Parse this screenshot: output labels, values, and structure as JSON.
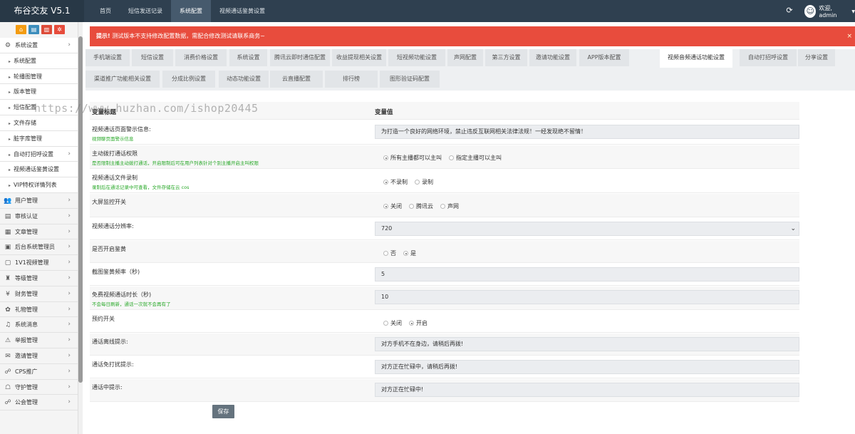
{
  "app": {
    "title": "布谷交友 V5.1"
  },
  "topnav": [
    "首页",
    "短信发送记录",
    "系统配置",
    "视频通话鉴黄设置"
  ],
  "topnav_active": 2,
  "user": {
    "greeting": "欢迎, admin"
  },
  "sidebar": {
    "quick_colors": [
      "#f39c12",
      "#3c8dbc",
      "#dd4b39",
      "#e74c3c"
    ],
    "items": [
      {
        "label": "系统设置",
        "icon": "⚙",
        "icon_name": "gear-icon",
        "type": "group-open",
        "arrow": "›"
      },
      {
        "label": "系统配置",
        "type": "sub"
      },
      {
        "label": "轮播图管理",
        "type": "sub"
      },
      {
        "label": "版本管理",
        "type": "sub"
      },
      {
        "label": "短信配置",
        "type": "sub"
      },
      {
        "label": "文件存储",
        "type": "sub"
      },
      {
        "label": "脏字库管理",
        "type": "sub"
      },
      {
        "label": "自动打招呼设置",
        "type": "sub",
        "arrow": "›"
      },
      {
        "label": "视频通话鉴黄设置",
        "type": "sub"
      },
      {
        "label": "VIP特权详情列表",
        "type": "sub"
      },
      {
        "label": "用户管理",
        "icon": "👥",
        "icon_name": "users-icon",
        "type": "group",
        "arrow": "›"
      },
      {
        "label": "审核认证",
        "icon": "▤",
        "icon_name": "id-card-icon",
        "type": "group",
        "arrow": "›"
      },
      {
        "label": "文章管理",
        "icon": "▦",
        "icon_name": "grid-icon",
        "type": "group",
        "arrow": "›"
      },
      {
        "label": "后台系统管理员",
        "icon": "▣",
        "icon_name": "admin-card-icon",
        "type": "group",
        "arrow": "›"
      },
      {
        "label": "1V1视频管理",
        "icon": "▢",
        "icon_name": "video-icon",
        "type": "group",
        "arrow": "›"
      },
      {
        "label": "等级管理",
        "icon": "♜",
        "icon_name": "hierarchy-icon",
        "type": "group",
        "arrow": "›"
      },
      {
        "label": "财务管理",
        "icon": "¥",
        "icon_name": "yen-icon",
        "type": "group",
        "arrow": "›"
      },
      {
        "label": "礼物管理",
        "icon": "✿",
        "icon_name": "gift-icon",
        "type": "group",
        "arrow": "›"
      },
      {
        "label": "系统消息",
        "icon": "♫",
        "icon_name": "bell-icon",
        "type": "group",
        "arrow": "›"
      },
      {
        "label": "举报管理",
        "icon": "⚠",
        "icon_name": "report-icon",
        "type": "group",
        "arrow": "›"
      },
      {
        "label": "邀请管理",
        "icon": "✉",
        "icon_name": "invite-icon",
        "type": "group",
        "arrow": "›"
      },
      {
        "label": "CPS推广",
        "icon": "☍",
        "icon_name": "handshake-icon",
        "type": "group",
        "arrow": "›"
      },
      {
        "label": "守护管理",
        "icon": "☖",
        "icon_name": "guard-icon",
        "type": "group",
        "arrow": "›"
      },
      {
        "label": "公会管理",
        "icon": "☍",
        "icon_name": "guild-icon",
        "type": "group",
        "arrow": "›"
      }
    ]
  },
  "alert": {
    "strong": "提示!",
    "text": "测试版本不支持修改配置数据，需配合修改测试请联系商务~",
    "close": "×"
  },
  "tabs_row1": [
    "手机端设置",
    "短信设置",
    "消费价格设置",
    "系统设置",
    "腾讯云即时通信配置",
    "收益提现相关设置",
    "短视频功能设置",
    "声网配置",
    "第三方设置",
    "邀请功能设置",
    "APP版本配置",
    "视频音频通话功能设置",
    "自动打招呼设置",
    "分享设置"
  ],
  "tabs_row2": [
    "渠道推广功能相关设置",
    "分成比例设置",
    "动态功能设置",
    "云直播配置",
    "排行榜",
    "图形验证码配置"
  ],
  "tabs_active": "视频音频通话功能设置",
  "watermark": "https://www.huzhan.com/ishop20445",
  "form": {
    "header": {
      "col1": "变量标题",
      "col2": "变量值"
    },
    "rows": [
      {
        "label": "视频通话页面警示信息:",
        "hint": "视频聊页面警示信息",
        "kind": "input",
        "value": "为打造一个良好的网络环境，禁止违反互联网相关法律法规！一经发现绝不留情！"
      },
      {
        "label": "主动拨打通话权限",
        "hint": "是否限制主播主动拨打通话，开启限制后可在用户列表针对个别主播开启主叫权限",
        "kind": "radio",
        "options": [
          "所有主播都可以主叫",
          "指定主播可以主叫"
        ],
        "selected": 0
      },
      {
        "label": "视频通话文件录制",
        "hint": "录制后在通话记录中可查看，文件存储在云 cos",
        "kind": "radio",
        "options": [
          "不录制",
          "录制"
        ],
        "selected": 0
      },
      {
        "label": "大屏监控开关",
        "hint": "",
        "kind": "radio",
        "options": [
          "关闭",
          "腾讯云",
          "声网"
        ],
        "selected": 0
      },
      {
        "label": "视频通话分辨率:",
        "hint": "",
        "kind": "select",
        "value": "720"
      },
      {
        "label": "是否开启鉴黄",
        "hint": "",
        "kind": "radio",
        "options": [
          "否",
          "是"
        ],
        "selected": 1
      },
      {
        "label": "截图鉴黄频率（秒)",
        "hint": "",
        "kind": "input",
        "value": "5"
      },
      {
        "label": "免费视频通话时长（秒)",
        "hint": "不会每日刷新，通话一次就不会再有了",
        "kind": "input",
        "value": "10"
      },
      {
        "label": "预约开关",
        "hint": "",
        "kind": "radio",
        "options": [
          "关闭",
          "开启"
        ],
        "selected": 1
      },
      {
        "label": "通话离线提示:",
        "hint": "",
        "kind": "input",
        "value": "对方手机不在身边，请稍后再拨!"
      },
      {
        "label": "通话免打扰提示:",
        "hint": "",
        "kind": "input",
        "value": "对方正在忙碌中，请稍后再拨!"
      },
      {
        "label": "通话中提示:",
        "hint": "",
        "kind": "input",
        "value": "对方正在忙碌中!"
      }
    ]
  },
  "save_label": "保存"
}
